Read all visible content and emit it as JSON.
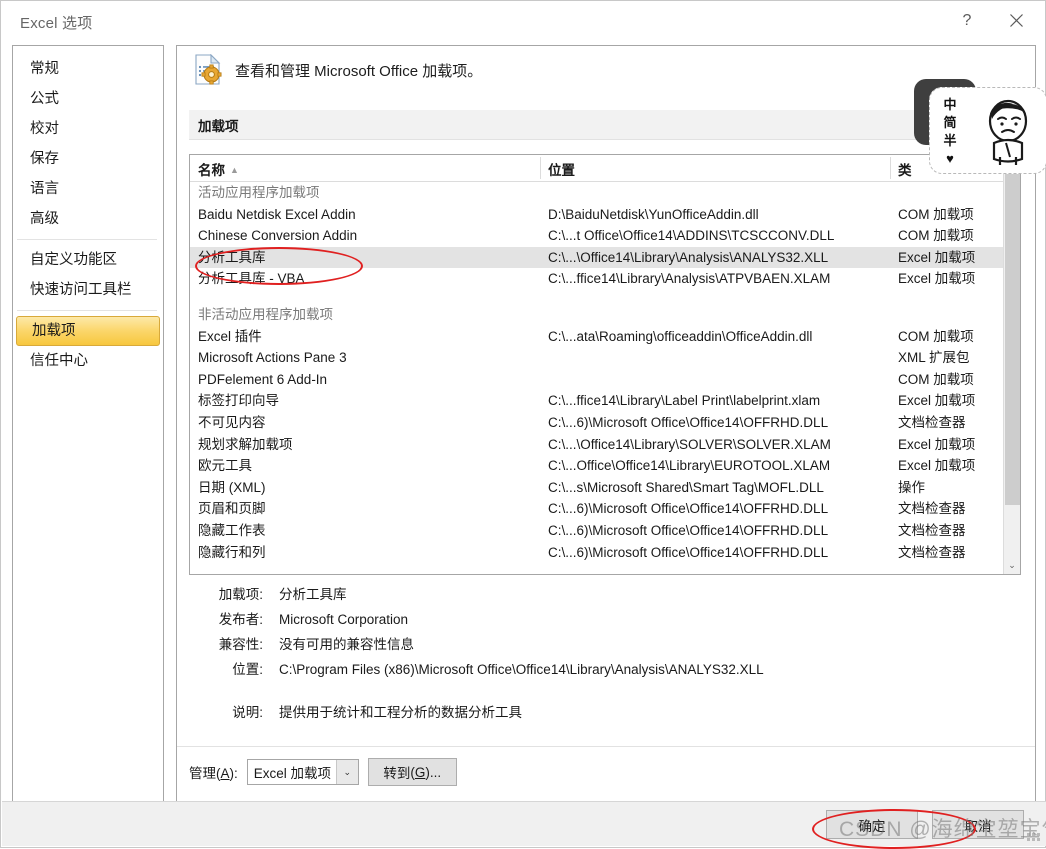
{
  "window": {
    "title": "Excel 选项",
    "help_icon": "help-icon",
    "close_icon": "close-icon"
  },
  "sidebar": {
    "items": [
      {
        "label": "常规",
        "selected": false
      },
      {
        "label": "公式",
        "selected": false
      },
      {
        "label": "校对",
        "selected": false
      },
      {
        "label": "保存",
        "selected": false
      },
      {
        "label": "语言",
        "selected": false
      },
      {
        "label": "高级",
        "selected": false
      },
      {
        "label": "自定义功能区",
        "selected": false
      },
      {
        "label": "快速访问工具栏",
        "selected": false
      },
      {
        "label": "加载项",
        "selected": true
      },
      {
        "label": "信任中心",
        "selected": false
      }
    ]
  },
  "content": {
    "header_title": "查看和管理 Microsoft Office 加载项。",
    "header_icon": "addin-document-gear-icon",
    "section_label": "加载项"
  },
  "table": {
    "columns": [
      "名称",
      "位置",
      "类"
    ],
    "sort_column": "名称",
    "sort_direction": "ascending",
    "groups": [
      {
        "title": "活动应用程序加载项",
        "rows": [
          {
            "name": "Baidu Netdisk Excel Addin",
            "location": "D:\\BaiduNetdisk\\YunOfficeAddin.dll",
            "type": "COM 加载项",
            "selected": false
          },
          {
            "name": "Chinese Conversion Addin",
            "location": "C:\\...t Office\\Office14\\ADDINS\\TCSCCONV.DLL",
            "type": "COM 加载项",
            "selected": false
          },
          {
            "name": "分析工具库",
            "location": "C:\\...\\Office14\\Library\\Analysis\\ANALYS32.XLL",
            "type": "Excel 加载项",
            "selected": true
          },
          {
            "name": "分析工具库 - VBA",
            "location": "C:\\...ffice14\\Library\\Analysis\\ATPVBAEN.XLAM",
            "type": "Excel 加载项",
            "selected": false
          }
        ]
      },
      {
        "title": "非活动应用程序加载项",
        "rows": [
          {
            "name": "Excel 插件",
            "location": "C:\\...ata\\Roaming\\officeaddin\\OfficeAddin.dll",
            "type": "COM 加载项",
            "selected": false
          },
          {
            "name": "Microsoft Actions Pane 3",
            "location": "",
            "type": "XML 扩展包",
            "selected": false
          },
          {
            "name": "PDFelement 6 Add-In",
            "location": "",
            "type": "COM 加载项",
            "selected": false
          },
          {
            "name": "标签打印向导",
            "location": "C:\\...ffice14\\Library\\Label Print\\labelprint.xlam",
            "type": "Excel 加载项",
            "selected": false
          },
          {
            "name": "不可见内容",
            "location": "C:\\...6)\\Microsoft Office\\Office14\\OFFRHD.DLL",
            "type": "文档检查器",
            "selected": false
          },
          {
            "name": "规划求解加载项",
            "location": "C:\\...\\Office14\\Library\\SOLVER\\SOLVER.XLAM",
            "type": "Excel 加载项",
            "selected": false
          },
          {
            "name": "欧元工具",
            "location": "C:\\...Office\\Office14\\Library\\EUROTOOL.XLAM",
            "type": "Excel 加载项",
            "selected": false
          },
          {
            "name": "日期 (XML)",
            "location": "C:\\...s\\Microsoft Shared\\Smart Tag\\MOFL.DLL",
            "type": "操作",
            "selected": false
          },
          {
            "name": "页眉和页脚",
            "location": "C:\\...6)\\Microsoft Office\\Office14\\OFFRHD.DLL",
            "type": "文档检查器",
            "selected": false
          },
          {
            "name": "隐藏工作表",
            "location": "C:\\...6)\\Microsoft Office\\Office14\\OFFRHD.DLL",
            "type": "文档检查器",
            "selected": false
          },
          {
            "name": "隐藏行和列",
            "location": "C:\\...6)\\Microsoft Office\\Office14\\OFFRHD.DLL",
            "type": "文档检查器",
            "selected": false
          }
        ]
      }
    ]
  },
  "details": {
    "addin_label": "加载项:",
    "addin_value": "分析工具库",
    "publisher_label": "发布者:",
    "publisher_value": "Microsoft Corporation",
    "compat_label": "兼容性:",
    "compat_value": "没有可用的兼容性信息",
    "location_label": "位置:",
    "location_value": "C:\\Program Files (x86)\\Microsoft Office\\Office14\\Library\\Analysis\\ANALYS32.XLL",
    "desc_label": "说明:",
    "desc_value": "提供用于统计和工程分析的数据分析工具"
  },
  "manage": {
    "label_prefix": "管理",
    "label_accel": "A",
    "label_suffix": "):",
    "selected_value": "Excel 加载项",
    "dropdown_icon": "chevron-down-icon",
    "goto_prefix": "转到",
    "goto_accel": "G",
    "goto_suffix": ")..."
  },
  "footer": {
    "ok_label": "确定",
    "cancel_label": "取消"
  },
  "ime": {
    "mode_chinese": "中",
    "mode_simplified": "简",
    "mode_halfwidth": "半",
    "mode_heart": "♥",
    "avatar_icon": "ime-character-avatar-icon"
  },
  "watermark": {
    "text": "CSDN @海绵宝堃宝气"
  },
  "annotations": [
    {
      "name": "annotation-ellipse-selected-addin",
      "color": "#e02020"
    },
    {
      "name": "annotation-ellipse-ok-button",
      "color": "#e02020"
    }
  ]
}
